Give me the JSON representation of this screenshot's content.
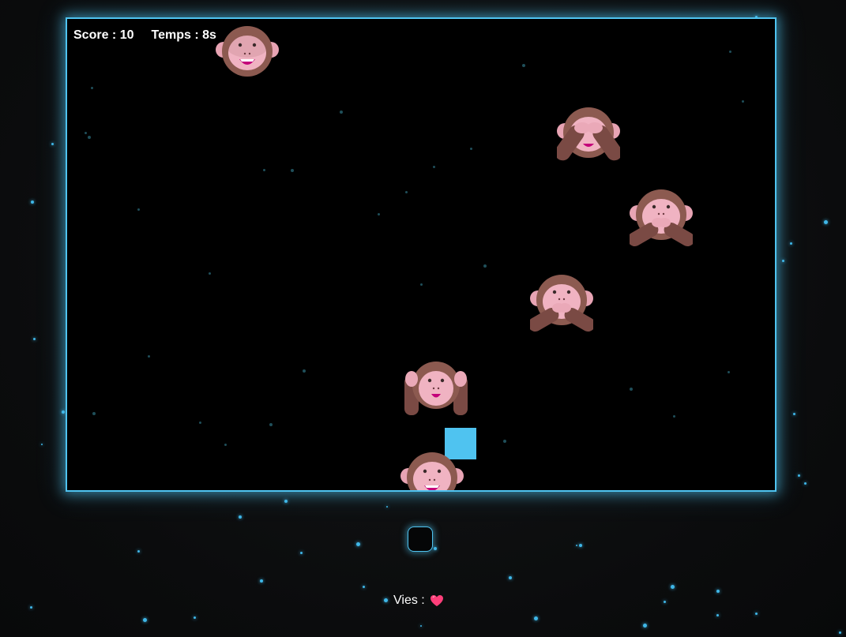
{
  "hud": {
    "score_text": "Score : 10",
    "time_text": "Temps : 8s"
  },
  "lives": {
    "label": "Vies :",
    "count": 1,
    "icon": "heart-icon",
    "heart_color": "#ff3f7a"
  },
  "game": {
    "player_color": "#4fc3f0",
    "border_color": "#4fc3f0",
    "enemies": [
      {
        "type": "monkey-face-icon"
      },
      {
        "type": "see-no-evil-monkey-icon"
      },
      {
        "type": "speak-no-evil-monkey-icon"
      },
      {
        "type": "speak-no-evil-monkey-icon"
      },
      {
        "type": "hear-no-evil-monkey-icon"
      },
      {
        "type": "monkey-face-icon"
      }
    ]
  },
  "colors": {
    "accent": "#4fc3f0",
    "background": "#0d0e0f",
    "canvas": "#000000"
  }
}
